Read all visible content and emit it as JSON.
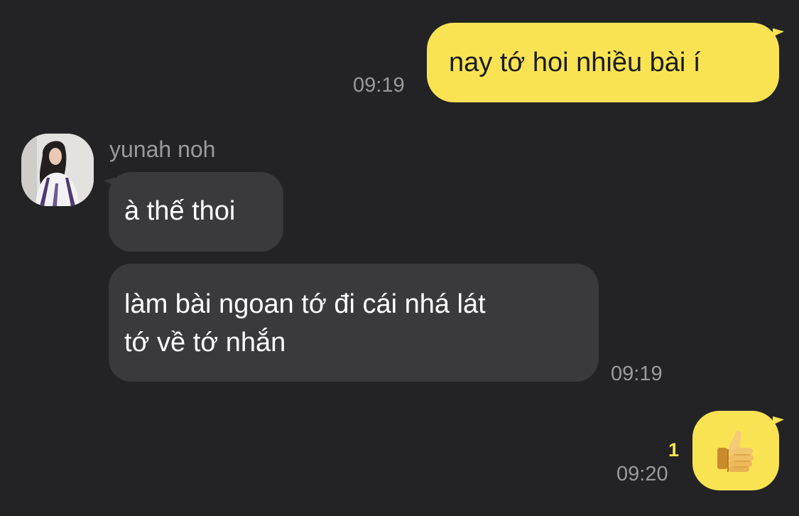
{
  "messages": [
    {
      "direction": "out",
      "text": "nay tớ hoi nhiều bài í",
      "time": "09:19"
    },
    {
      "direction": "in",
      "sender": "yunah noh",
      "text": "à thế thoi"
    },
    {
      "direction": "in",
      "text": "làm bài ngoan tớ đi cái nhá lát\ntớ về tớ nhắn",
      "time": "09:19"
    },
    {
      "direction": "out",
      "emoji": "thumbs-up",
      "unread": "1",
      "time": "09:20"
    }
  ],
  "colors": {
    "background": "#232325",
    "outgoing_bubble": "#f9e353",
    "incoming_bubble": "#3a3a3c",
    "timestamp": "#9a9a9e",
    "unread_count": "#f9e353"
  },
  "icons": {
    "avatar": "profile-photo",
    "reaction": "thumbs-up-icon"
  }
}
